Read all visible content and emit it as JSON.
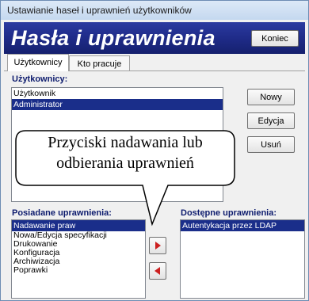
{
  "window": {
    "title": "Ustawianie haseł i uprawnień użytkowników"
  },
  "header": {
    "app_title": "Hasła i uprawnienia",
    "close_label": "Koniec"
  },
  "tabs": [
    {
      "label": "Użytkownicy",
      "active": true
    },
    {
      "label": "Kto pracuje",
      "active": false
    }
  ],
  "users": {
    "label": "Użytkownicy:",
    "items": [
      {
        "label": "Użytkownik",
        "selected": false
      },
      {
        "label": "Administrator",
        "selected": true
      }
    ],
    "buttons": {
      "new": "Nowy",
      "edit": "Edycja",
      "delete": "Usuń"
    }
  },
  "owned": {
    "label": "Posiadane uprawnienia:",
    "items": [
      {
        "label": "Nadawanie praw",
        "selected": true
      },
      {
        "label": "Nowa/Edycja specyfikacji",
        "selected": false
      },
      {
        "label": "Drukowanie",
        "selected": false
      },
      {
        "label": "Konfiguracja",
        "selected": false
      },
      {
        "label": "Archiwizacja",
        "selected": false
      },
      {
        "label": "Poprawki",
        "selected": false
      }
    ]
  },
  "available": {
    "label": "Dostępne uprawnienia:",
    "items": [
      {
        "label": "Autentykacja przez LDAP",
        "selected": true
      }
    ]
  },
  "arrows": {
    "grant_icon": "arrow-right-icon",
    "revoke_icon": "arrow-left-icon"
  },
  "callout": {
    "text": "Przyciski nadawania lub odbierania uprawnień"
  },
  "colors": {
    "header": "#1e2a86",
    "selection": "#1a2e8a",
    "label": "#0e1c6e",
    "arrow": "#cc1f1f"
  }
}
